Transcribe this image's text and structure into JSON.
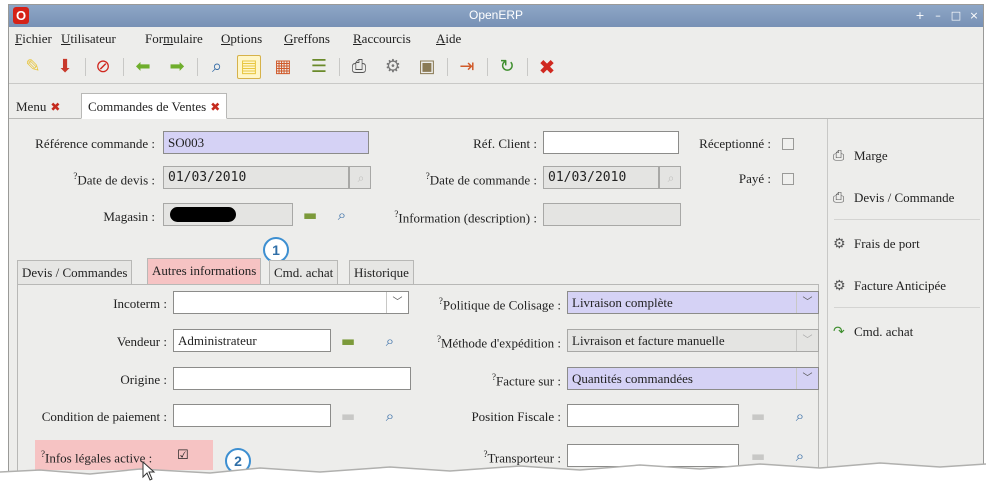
{
  "window": {
    "logo": "O",
    "title": "OpenERP",
    "controls": [
      "+",
      "–",
      "□",
      "×"
    ]
  },
  "menubar": {
    "items": [
      {
        "u": "F",
        "rest": "ichier"
      },
      {
        "u": "U",
        "rest": "tilisateur"
      },
      {
        "pre": "For",
        "u": "m",
        "rest": "ulaire"
      },
      {
        "u": "O",
        "rest": "ptions"
      },
      {
        "u": "G",
        "rest": "reffons"
      },
      {
        "u": "R",
        "rest": "accourcis"
      },
      {
        "u": "A",
        "rest": "ide"
      }
    ]
  },
  "toolbar": {
    "icons": [
      "new-icon",
      "save-icon",
      "delete-icon",
      "previous-icon",
      "next-icon",
      "find-icon",
      "form-view-icon",
      "chart-view-icon",
      "list-view-icon",
      "print-icon",
      "action-icon",
      "attachment-icon",
      "export-icon",
      "reload-icon",
      "close-icon"
    ]
  },
  "doc_tabs": [
    {
      "label": "Menu"
    },
    {
      "label": "Commandes de Ventes"
    }
  ],
  "header": {
    "ref_label": "Référence commande :",
    "ref_value": "SO003",
    "client_ref_label": "Réf. Client :",
    "client_ref_value": "",
    "received_label": "Réceptionné :",
    "quote_date_label": "Date de devis :",
    "quote_date_value": "01/03/2010",
    "order_date_label": "Date de commande :",
    "order_date_value": "01/03/2010",
    "paid_label": "Payé :",
    "shop_label": "Magasin :",
    "info_label": "Information (description) :",
    "q": "?"
  },
  "notebook": {
    "tabs": [
      "Devis / Commandes",
      "Autres informations",
      "Cmd. achat",
      "Historique"
    ],
    "active": "Autres informations"
  },
  "other_info": {
    "incoterm_label": "Incoterm :",
    "incoterm_value": "",
    "salesman_label": "Vendeur :",
    "salesman_value": "Administrateur",
    "origin_label": "Origine :",
    "origin_value": "",
    "payment_term_label": "Condition de paiement :",
    "payment_term_value": "",
    "legal_info_label": "Infos légales active :",
    "legal_info_checked": "☑",
    "packing_policy_label": "Politique de Colisage :",
    "packing_policy_value": "Livraison complète",
    "shipping_method_label": "Méthode d'expédition :",
    "shipping_method_value": "Livraison et facture manuelle",
    "invoice_on_label": "Facture sur :",
    "invoice_on_value": "Quantités commandées",
    "fiscal_position_label": "Position Fiscale :",
    "fiscal_position_value": "",
    "carrier_label": "Transporteur :",
    "carrier_value": ""
  },
  "callouts": [
    "1",
    "2"
  ],
  "sidebar": {
    "items": [
      {
        "label": "Marge",
        "icon": "printer-icon"
      },
      {
        "label": "Devis / Commande",
        "icon": "printer-icon"
      },
      {
        "label": "Frais de port",
        "icon": "gears-icon"
      },
      {
        "label": "Facture Anticipée",
        "icon": "gears-icon"
      },
      {
        "label": "Cmd. achat",
        "icon": "arrow-icon"
      }
    ]
  },
  "colors": {
    "required_field": "#d5d2f5",
    "highlight": "#f6c3c3",
    "title_bar": "#7f98bb",
    "callout_ring": "#3d8fd1"
  }
}
